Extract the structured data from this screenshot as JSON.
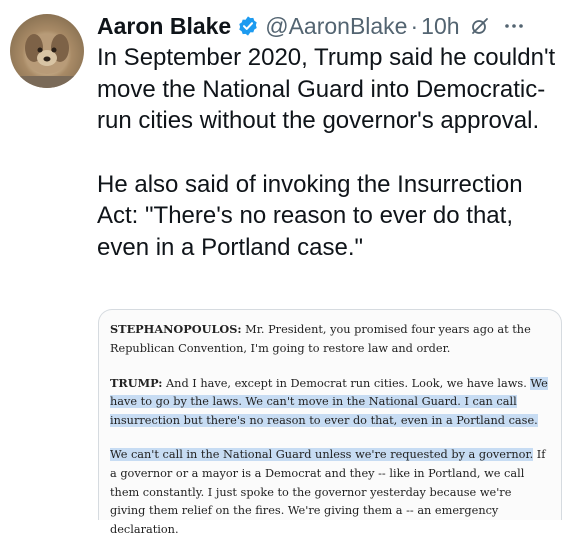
{
  "author": {
    "name": "Aaron Blake",
    "handle": "@AaronBlake",
    "separator": "·",
    "time": "10h"
  },
  "tweet": {
    "paragraphs": [
      "In September 2020, Trump said he couldn't move the National Guard into Democratic-run cities without the governor's approval.",
      "He also said of invoking the Insurrection Act: \"There's no reason to ever do that, even in a Portland case.\""
    ]
  },
  "transcript": {
    "p1": {
      "speaker": "STEPHANOPOULOS:",
      "text": " Mr. President, you promised four years ago at the Republican Convention, I'm going to restore law and order."
    },
    "p2": {
      "speaker": "TRUMP:",
      "text_plain": " And I have, except in Democrat run cities. Look, we have laws. ",
      "text_highlight": "We have to go by the laws. We can't move in the National Guard. I can call insurrection but there's no reason to ever do that, even in a Portland case."
    },
    "p3": {
      "text_highlight": "We can't call in the National Guard unless we're requested by a governor.",
      "text_plain": " If a governor or a mayor is a Democrat and they -- like in Portland, we call them constantly. I just spoke to the governor yesterday because we're giving them relief on the fires. We're giving them a -- an emergency declaration."
    }
  },
  "colors": {
    "verified_badge": "#1d9bf0",
    "highlight": "#c7dcf3",
    "secondary_text": "#536471"
  },
  "icons": [
    "avatar",
    "verified-badge-icon",
    "grok-icon",
    "more-icon"
  ]
}
